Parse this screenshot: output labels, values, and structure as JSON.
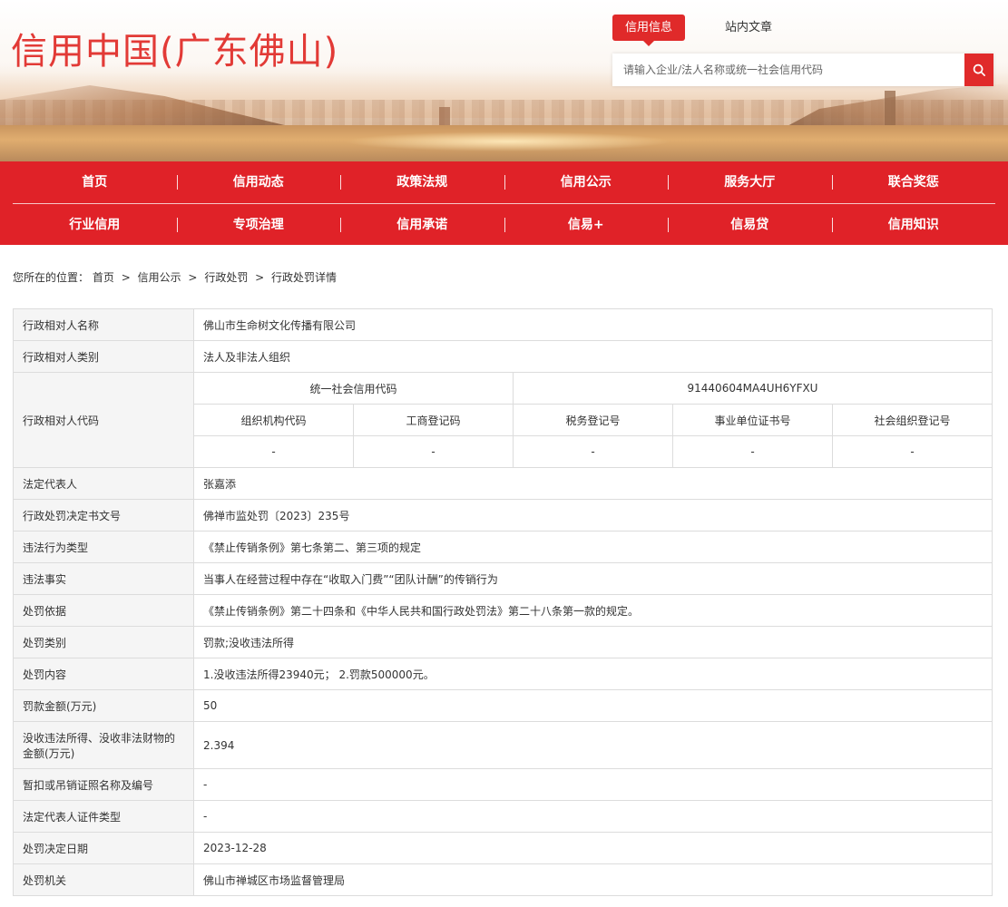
{
  "header": {
    "site_title": "信用中国(广东佛山)",
    "search_tabs": [
      {
        "label": "信用信息",
        "active": true
      },
      {
        "label": "站内文章",
        "active": false
      }
    ],
    "search_placeholder": "请输入企业/法人名称或统一社会信用代码",
    "search_icon": "search-icon"
  },
  "nav": {
    "row1": [
      "首页",
      "信用动态",
      "政策法规",
      "信用公示",
      "服务大厅",
      "联合奖惩"
    ],
    "row2": [
      "行业信用",
      "专项治理",
      "信用承诺",
      "信易+",
      "信易贷",
      "信用知识"
    ]
  },
  "breadcrumb": {
    "prefix": "您所在的位置：",
    "items": [
      "首页",
      "信用公示",
      "行政处罚",
      "行政处罚详情"
    ],
    "separator": ">"
  },
  "detail": {
    "name_label": "行政相对人名称",
    "name_value": "佛山市生命树文化传播有限公司",
    "type_label": "行政相对人类别",
    "type_value": "法人及非法人组织",
    "code_label": "行政相对人代码",
    "uscc_label": "统一社会信用代码",
    "uscc_value": "91440604MA4UH6YFXU",
    "sub_headers": [
      "组织机构代码",
      "工商登记码",
      "税务登记号",
      "事业单位证书号",
      "社会组织登记号"
    ],
    "sub_values": [
      "-",
      "-",
      "-",
      "-",
      "-"
    ],
    "rows": [
      {
        "label": "法定代表人",
        "value": "张嘉添"
      },
      {
        "label": "行政处罚决定书文号",
        "value": "佛禅市监处罚〔2023〕235号"
      },
      {
        "label": "违法行为类型",
        "value": "《禁止传销条例》第七条第二、第三项的规定"
      },
      {
        "label": "违法事实",
        "value": "当事人在经营过程中存在“收取入门费”“团队计酬”的传销行为"
      },
      {
        "label": "处罚依据",
        "value": "《禁止传销条例》第二十四条和《中华人民共和国行政处罚法》第二十八条第一款的规定。"
      },
      {
        "label": "处罚类别",
        "value": "罚款;没收违法所得"
      },
      {
        "label": "处罚内容",
        "value": "1.没收违法所得23940元； 2.罚款500000元。"
      },
      {
        "label": "罚款金额(万元)",
        "value": "50"
      }
    ],
    "confiscation_label": "没收违法所得、没收非法财物的金额(万元)",
    "confiscation_value": "2.394",
    "rows_after": [
      {
        "label": "暂扣或吊销证照名称及编号",
        "value": "-"
      },
      {
        "label": "法定代表人证件类型",
        "value": "-"
      },
      {
        "label": "处罚决定日期",
        "value": "2023-12-28"
      },
      {
        "label": "处罚机关",
        "value": "佛山市禅城区市场监督管理局"
      }
    ]
  },
  "colors": {
    "brand_red": "#e02228",
    "title_red": "#e23a36",
    "label_bg": "#f5f5f5",
    "border": "#dcdcdc"
  }
}
